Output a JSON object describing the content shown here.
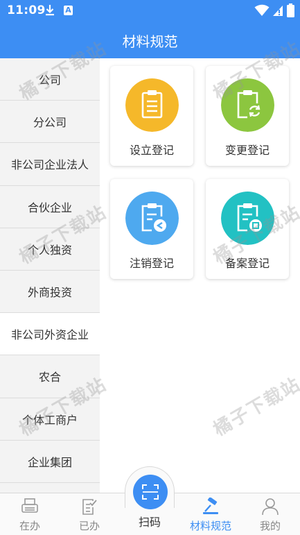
{
  "status_bar": {
    "time": "11:09",
    "download_icon": "download-icon",
    "app_badge": "A"
  },
  "header": {
    "title": "材料规范"
  },
  "sidebar": {
    "items": [
      {
        "label": "公司",
        "active": false
      },
      {
        "label": "分公司",
        "active": false
      },
      {
        "label": "非公司企业法人",
        "active": false
      },
      {
        "label": "合伙企业",
        "active": false
      },
      {
        "label": "个人独资",
        "active": false
      },
      {
        "label": "外商投资",
        "active": false
      },
      {
        "label": "非公司外资企业",
        "active": true
      },
      {
        "label": "农合",
        "active": false
      },
      {
        "label": "个体工商户",
        "active": false
      },
      {
        "label": "企业集团",
        "active": false
      }
    ]
  },
  "cards": [
    {
      "label": "设立登记",
      "icon": "clipboard-list-icon",
      "color": "#f5b82a"
    },
    {
      "label": "变更登记",
      "icon": "clipboard-refresh-icon",
      "color": "#8cc63f"
    },
    {
      "label": "注销登记",
      "icon": "clipboard-back-icon",
      "color": "#4ea9ef"
    },
    {
      "label": "备案登记",
      "icon": "clipboard-stamp-icon",
      "color": "#22c1c3"
    }
  ],
  "watermark": "橘子下载站",
  "tabbar": {
    "tabs": [
      {
        "label": "在办",
        "icon": "printer-icon",
        "active": false
      },
      {
        "label": "已办",
        "icon": "document-check-icon",
        "active": false
      },
      {
        "label": "材料规范",
        "icon": "gavel-icon",
        "active": true
      },
      {
        "label": "我的",
        "icon": "user-icon",
        "active": false
      }
    ],
    "scan": {
      "label": "扫码",
      "icon": "scan-icon"
    }
  },
  "colors": {
    "primary": "#3d8ef3",
    "sidebar_bg": "#f3f3f3",
    "active_tab": "#3d8ef3"
  }
}
